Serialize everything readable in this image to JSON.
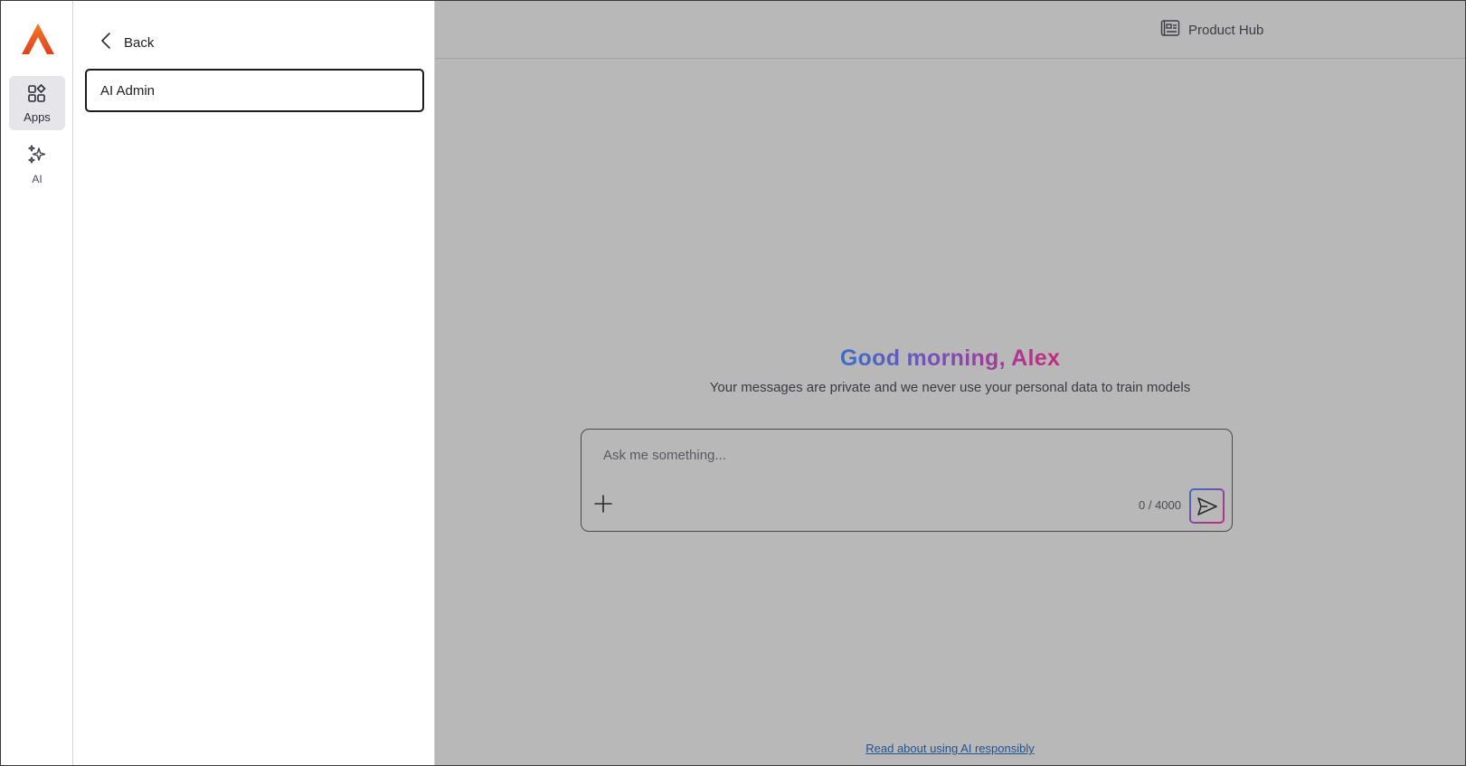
{
  "rail": {
    "logo": "app-logo",
    "items": [
      {
        "label": "Apps",
        "icon": "apps-grid-icon",
        "active": true
      },
      {
        "label": "AI",
        "icon": "sparkles-icon",
        "active": false
      }
    ]
  },
  "panel": {
    "back_label": "Back",
    "entries": [
      {
        "label": "AI Admin"
      }
    ]
  },
  "header": {
    "product_hub_label": "Product Hub",
    "product_hub_icon": "newspaper-icon"
  },
  "chat": {
    "greeting": "Good morning, Alex",
    "privacy_note": "Your messages are private and we never use your personal data to train models",
    "input_placeholder": "Ask me something...",
    "input_value": "",
    "char_count": "0 / 4000",
    "responsible_link": "Read about using AI responsibly"
  },
  "colors": {
    "overlay": "#b8b8b8",
    "logo_orange": "#e8531f",
    "gradient_start": "#3a6ec8",
    "gradient_end": "#c9287a",
    "link": "#24528f"
  }
}
